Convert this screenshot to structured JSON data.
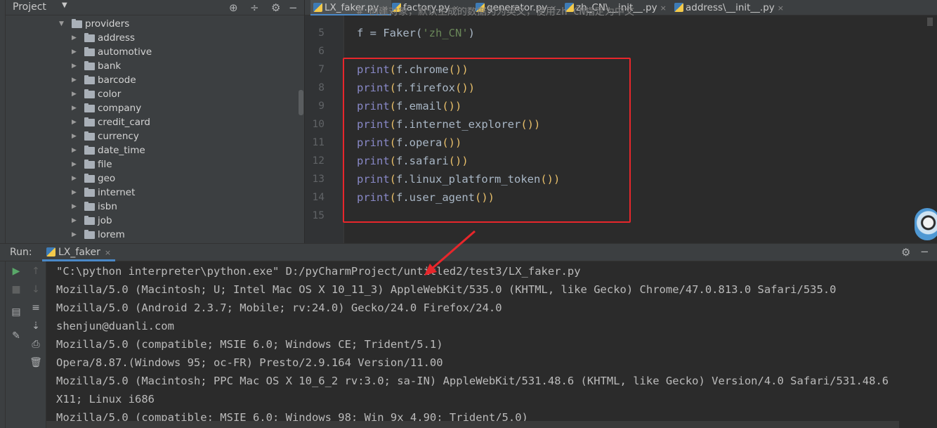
{
  "project": {
    "title": "Project",
    "tree": [
      {
        "label": "providers",
        "expanded": true,
        "level": 0
      },
      {
        "label": "address",
        "level": 1
      },
      {
        "label": "automotive",
        "level": 1
      },
      {
        "label": "bank",
        "level": 1
      },
      {
        "label": "barcode",
        "level": 1
      },
      {
        "label": "color",
        "level": 1
      },
      {
        "label": "company",
        "level": 1
      },
      {
        "label": "credit_card",
        "level": 1
      },
      {
        "label": "currency",
        "level": 1
      },
      {
        "label": "date_time",
        "level": 1
      },
      {
        "label": "file",
        "level": 1
      },
      {
        "label": "geo",
        "level": 1
      },
      {
        "label": "internet",
        "level": 1
      },
      {
        "label": "isbn",
        "level": 1
      },
      {
        "label": "job",
        "level": 1
      },
      {
        "label": "lorem",
        "level": 1
      }
    ]
  },
  "tabs": [
    {
      "label": "LX_faker.py",
      "active": true
    },
    {
      "label": "factory.py"
    },
    {
      "label": "generator.py"
    },
    {
      "label": "zh_CN\\__init__.py"
    },
    {
      "label": "address\\__init__.py"
    }
  ],
  "editor": {
    "partial_comment": "# 创建对象，默认生成的数据为为英文，使用zh_CN指定为中文",
    "lines": [
      {
        "n": "5",
        "func": "f",
        "rest1": " = Faker(",
        "str": "'zh_CN'",
        "rest2": ")"
      },
      {
        "n": "6"
      },
      {
        "n": "7",
        "print": "print",
        "open": "(",
        "call": "f.chrome",
        "call_parens": "()",
        "close": ")"
      },
      {
        "n": "8",
        "print": "print",
        "open": "(",
        "call": "f.firefox",
        "call_parens": "()",
        "close": ")"
      },
      {
        "n": "9",
        "print": "print",
        "open": "(",
        "call": "f.email",
        "call_parens": "()",
        "close": ")"
      },
      {
        "n": "10",
        "print": "print",
        "open": "(",
        "call": "f.internet_explorer",
        "call_parens": "()",
        "close": ")"
      },
      {
        "n": "11",
        "print": "print",
        "open": "(",
        "call": "f.opera",
        "call_parens": "()",
        "close": ")"
      },
      {
        "n": "12",
        "print": "print",
        "open": "(",
        "call": "f.safari",
        "call_parens": "()",
        "close": ")"
      },
      {
        "n": "13",
        "print": "print",
        "open": "(",
        "call": "f.linux_platform_token",
        "call_parens": "()",
        "close": ")"
      },
      {
        "n": "14",
        "print": "print",
        "open": "(",
        "call": "f.user_agent",
        "call_parens": "()",
        "close": ")"
      },
      {
        "n": "15"
      }
    ]
  },
  "run": {
    "label": "Run:",
    "tab": "LX_faker",
    "output": [
      "\"C:\\python interpreter\\python.exe\" D:/pyCharmProject/untitled2/test3/LX_faker.py",
      "Mozilla/5.0 (Macintosh; U; Intel Mac OS X 10_11_3) AppleWebKit/535.0 (KHTML, like Gecko) Chrome/47.0.813.0 Safari/535.0",
      "Mozilla/5.0 (Android 2.3.7; Mobile; rv:24.0) Gecko/24.0 Firefox/24.0",
      "shenjun@duanli.com",
      "Mozilla/5.0 (compatible; MSIE 6.0; Windows CE; Trident/5.1)",
      "Opera/8.87.(Windows 95; oc-FR) Presto/2.9.164 Version/11.00",
      "Mozilla/5.0 (Macintosh; PPC Mac OS X 10_6_2 rv:3.0; sa-IN) AppleWebKit/531.48.6 (KHTML, like Gecko) Version/4.0 Safari/531.48.6",
      "X11; Linux i686",
      "Mozilla/5.0 (compatible; MSIE 6.0; Windows 98; Win 9x 4.90; Trident/5.0)"
    ]
  },
  "colors": {
    "highlight": "#e8262b",
    "accent": "#4a88c7"
  }
}
